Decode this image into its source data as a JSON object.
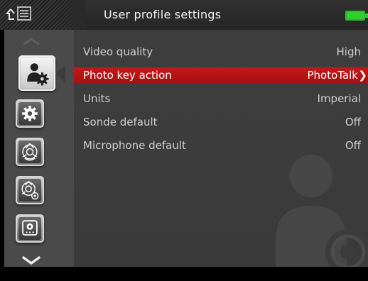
{
  "header": {
    "title": "User profile settings",
    "left_icons": [
      "upload-arrow-icon",
      "list-icon"
    ],
    "battery_icon": "battery-icon",
    "battery_color": "#2fd12f"
  },
  "sidebar": {
    "scroll_up_icon": "chevron-up-icon",
    "scroll_down_icon": "chevron-down-icon",
    "items": [
      {
        "icon": "user-settings-icon",
        "active": true
      },
      {
        "icon": "gear-icon",
        "active": false
      },
      {
        "icon": "camera-head-icon",
        "active": false
      },
      {
        "icon": "camera-head-settings-icon",
        "active": false
      },
      {
        "icon": "monitor-settings-icon",
        "active": false
      }
    ]
  },
  "settings": {
    "accent_color": "#b81515",
    "items": [
      {
        "label": "Video quality",
        "value": "High",
        "selected": false
      },
      {
        "label": "Photo key action",
        "value": "PhotoTalk",
        "selected": true
      },
      {
        "label": "Units",
        "value": "Imperial",
        "selected": false
      },
      {
        "label": "Sonde default",
        "value": "Off",
        "selected": false
      },
      {
        "label": "Microphone default",
        "value": "Off",
        "selected": false
      }
    ],
    "selected_chevron": "❯"
  },
  "watermark_icon": "user-gear-watermark-icon"
}
